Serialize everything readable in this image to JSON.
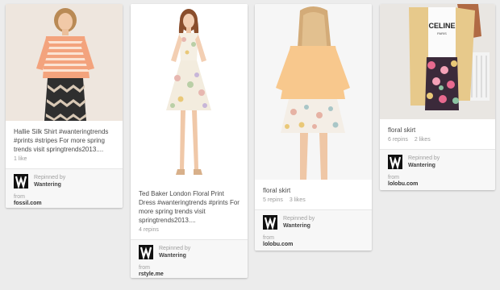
{
  "pins": [
    {
      "description": "Hallie Silk Shirt #wanteringtrends #prints #stripes For more spring trends visit springtrends2013....",
      "stats": [
        "1 like"
      ],
      "repinned_label": "Repinned by",
      "repinned_user": "Wantering",
      "from_label": "from",
      "source": "fossil.com",
      "photo_desc": "woman striped shirt patterned skirt"
    },
    {
      "description": "Ted Baker London Floral Print Dress #wanteringtrends #prints For more spring trends visit springtrends2013....",
      "stats": [
        "4 repins"
      ],
      "repinned_label": "Repinned by",
      "repinned_user": "Wantering",
      "from_label": "from",
      "source": "rstyle.me",
      "photo_desc": "woman floral print dress"
    },
    {
      "description": "floral skirt",
      "stats": [
        "5 repins",
        "3 likes"
      ],
      "repinned_label": "Repinned by",
      "repinned_user": "Wantering",
      "from_label": "from",
      "source": "lolobu.com",
      "photo_desc": "woman peach blouse floral skirt"
    },
    {
      "description": "floral skirt",
      "stats": [
        "6 repins",
        "2 likes"
      ],
      "repinned_label": "Repinned by",
      "repinned_user": "Wantering",
      "from_label": "from",
      "source": "lolobu.com",
      "photo_desc": "woman cardigan floral skirt"
    }
  ],
  "photo_texts": {
    "tshirt_print": "CELINE",
    "tshirt_sub": "PARIS"
  },
  "colors": {
    "page_bg": "#ececec",
    "card_bg": "#ffffff",
    "logo_bg": "#111111"
  }
}
